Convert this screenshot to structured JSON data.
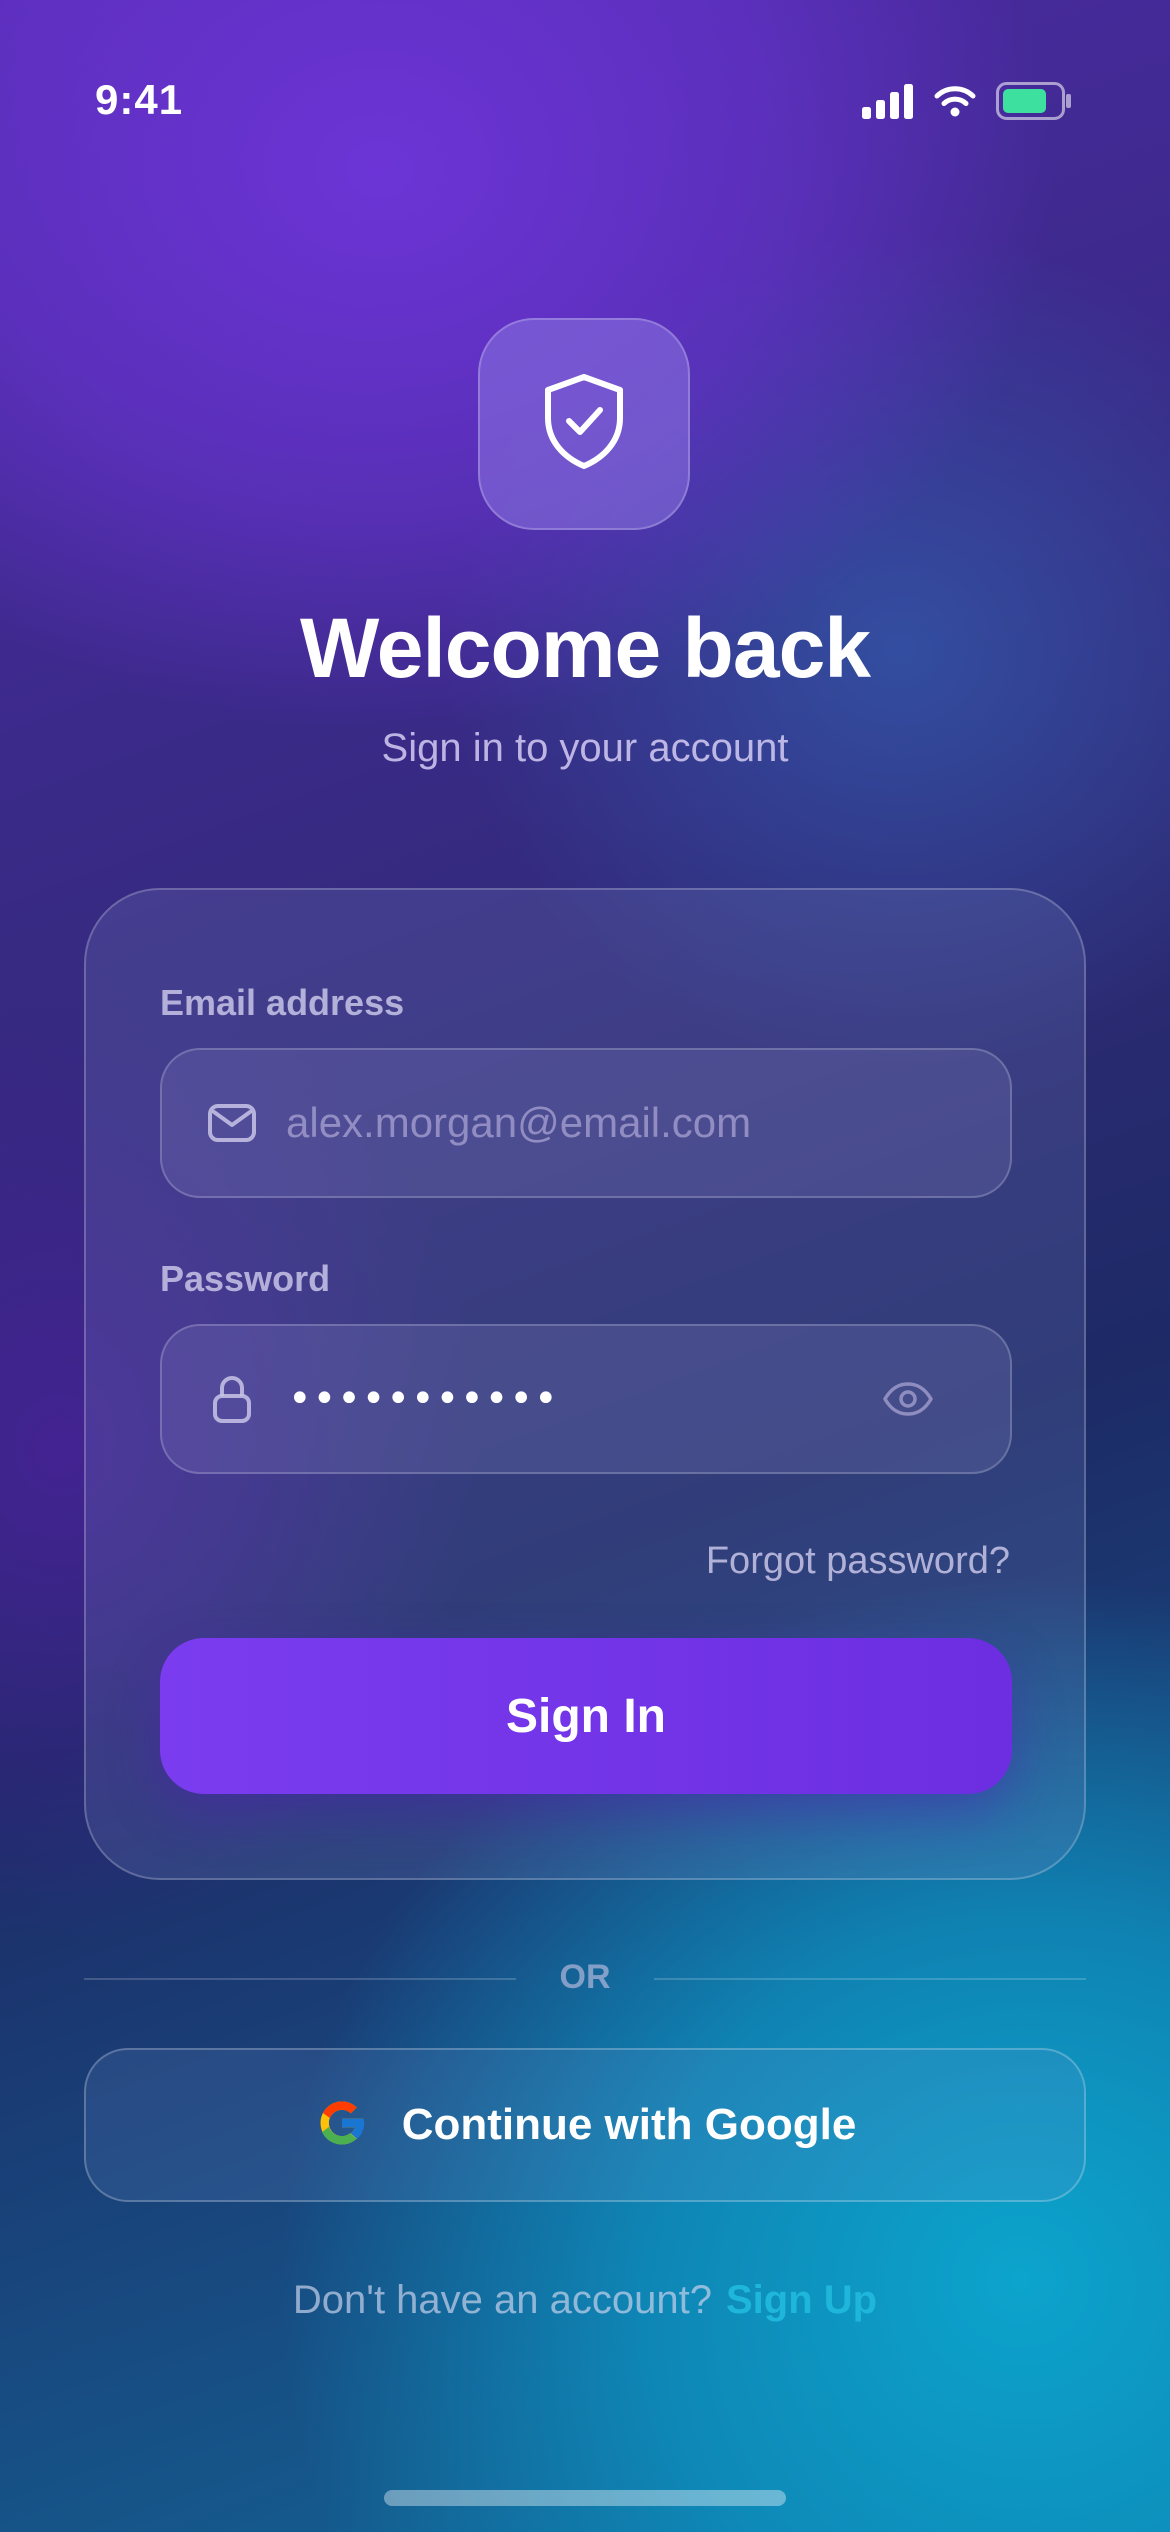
{
  "status_bar": {
    "time": "9:41",
    "icons": [
      "cellular-signal-icon",
      "wifi-icon",
      "battery-icon"
    ]
  },
  "hero": {
    "icon": "shield-check-icon",
    "title": "Welcome back",
    "subtitle": "Sign in to your account"
  },
  "form": {
    "email": {
      "label": "Email address",
      "placeholder": "alex.morgan@email.com",
      "value": "",
      "icon": "mail-icon"
    },
    "password": {
      "label": "Password",
      "masked_value": "•••••••••••",
      "icon": "lock-icon",
      "toggle_icon": "eye-icon"
    },
    "forgot_password": "Forgot password?",
    "submit_label": "Sign In"
  },
  "divider": {
    "label": "OR"
  },
  "google": {
    "label": "Continue with Google",
    "icon": "google-logo-icon"
  },
  "footer": {
    "prompt": "Don't have an account?",
    "link": "Sign Up"
  },
  "colors": {
    "accent": "#7b3cf0",
    "link": "#1fb6db",
    "battery": "#3ee0a0"
  }
}
